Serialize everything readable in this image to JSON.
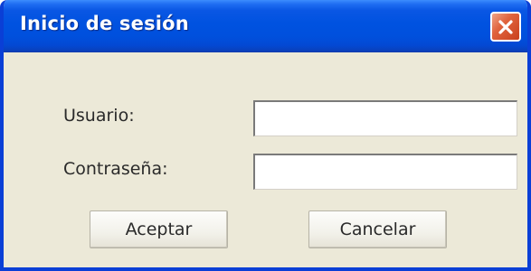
{
  "window": {
    "title": "Inicio de sesión"
  },
  "form": {
    "user_label": "Usuario:",
    "user_value": "",
    "password_label": "Contraseña:",
    "password_value": ""
  },
  "buttons": {
    "accept_label": "Aceptar",
    "cancel_label": "Cancelar"
  },
  "icons": {
    "close": "close-icon"
  },
  "colors": {
    "titlebar_blue": "#0052e0",
    "dialog_background": "#ece9d8",
    "close_button_red": "#e0633d"
  }
}
